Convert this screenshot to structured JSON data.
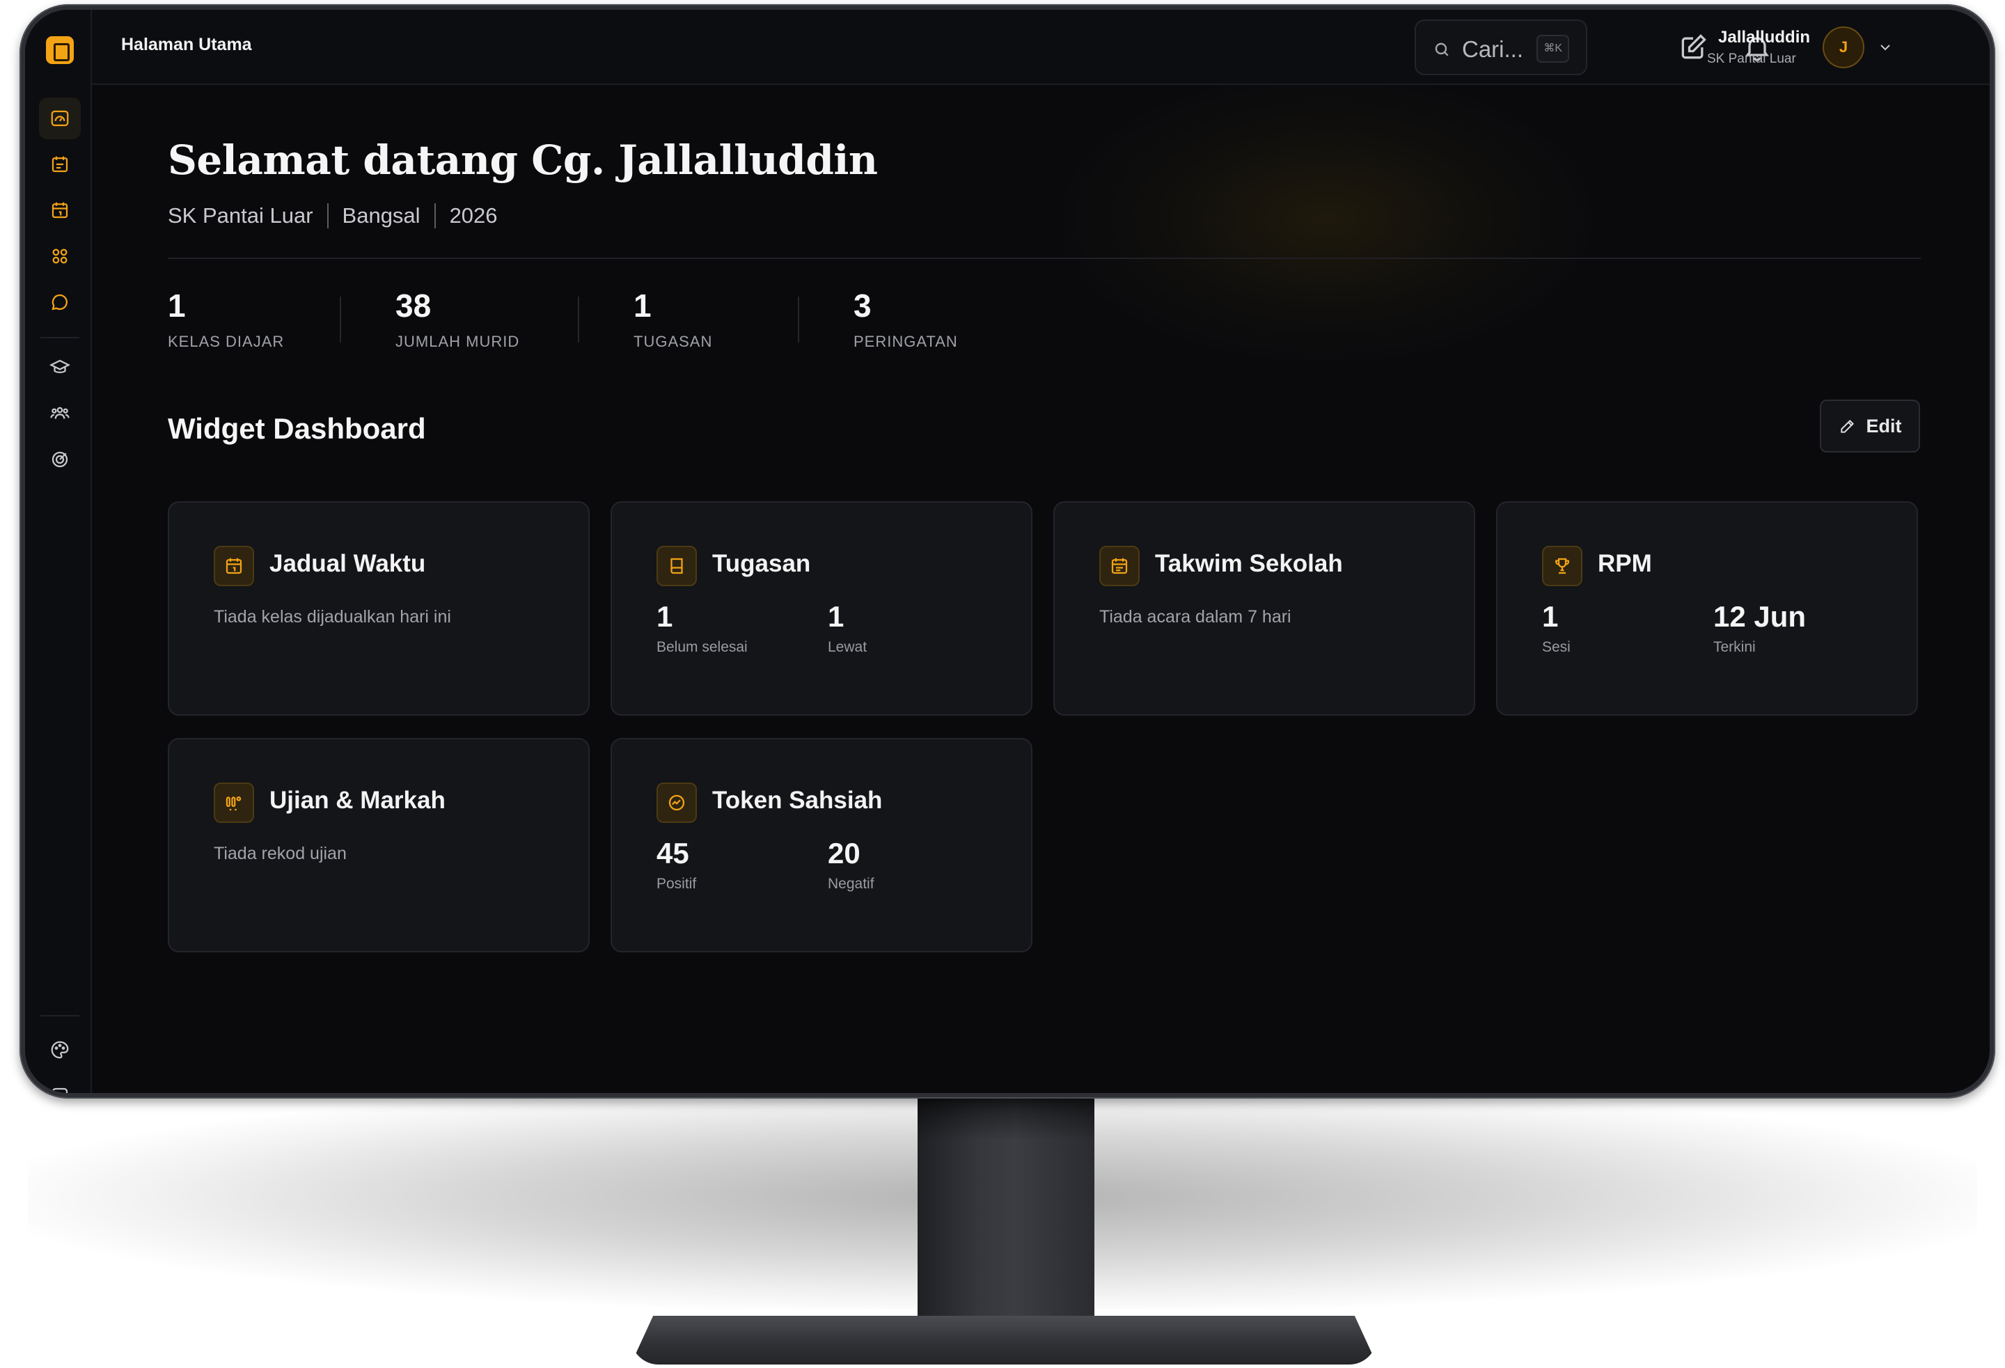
{
  "topbar": {
    "page_title": "Halaman Utama",
    "search_placeholder": "Cari...",
    "search_shortcut": "⌘K",
    "user": {
      "name": "Jallalluddin",
      "school": "SK Pantai Luar",
      "avatar_initial": "J"
    }
  },
  "sidebar": {
    "items": [
      {
        "icon": "dashboard-icon",
        "active": true
      },
      {
        "icon": "calendar-list-icon"
      },
      {
        "icon": "calendar-date-icon"
      },
      {
        "icon": "apps-grid-icon"
      },
      {
        "icon": "chat-bubble-icon"
      },
      {
        "icon": "graduation-cap-icon"
      },
      {
        "icon": "users-group-icon"
      },
      {
        "icon": "target-icon"
      }
    ],
    "bottom_items": [
      {
        "icon": "palette-icon"
      },
      {
        "icon": "document-icon"
      }
    ]
  },
  "welcome": {
    "title": "Selamat datang Cg. Jallalluddin",
    "school": "SK Pantai Luar",
    "location": "Bangsal",
    "year": "2026"
  },
  "stats": [
    {
      "value": "1",
      "label": "KELAS DIAJAR"
    },
    {
      "value": "38",
      "label": "JUMLAH MURID"
    },
    {
      "value": "1",
      "label": "TUGASAN"
    },
    {
      "value": "3",
      "label": "PERINGATAN"
    }
  ],
  "widgets": {
    "section_title": "Widget Dashboard",
    "edit_label": "Edit",
    "jadual": {
      "title": "Jadual Waktu",
      "empty": "Tiada kelas dijadualkan hari ini",
      "icon": "calendar-icon"
    },
    "tugasan": {
      "title": "Tugasan",
      "icon": "book-icon",
      "metrics": [
        {
          "value": "1",
          "label": "Belum selesai"
        },
        {
          "value": "1",
          "label": "Lewat"
        }
      ]
    },
    "takwim": {
      "title": "Takwim Sekolah",
      "empty": "Tiada acara dalam 7 hari",
      "icon": "calendar-event-icon"
    },
    "rpm": {
      "title": "RPM",
      "icon": "trophy-icon",
      "metrics": [
        {
          "value": "1",
          "label": "Sesi"
        },
        {
          "value": "12 Jun",
          "label": "Terkini"
        }
      ]
    },
    "ujian": {
      "title": "Ujian & Markah",
      "empty": "Tiada rekod ujian",
      "icon": "percent-chart-icon"
    },
    "token": {
      "title": "Token Sahsiah",
      "icon": "trend-icon",
      "metrics": [
        {
          "value": "45",
          "label": "Positif"
        },
        {
          "value": "20",
          "label": "Negatif"
        }
      ]
    }
  },
  "colors": {
    "accent": "#f3a316",
    "background": "#0a0a0d",
    "card": "#141519"
  }
}
